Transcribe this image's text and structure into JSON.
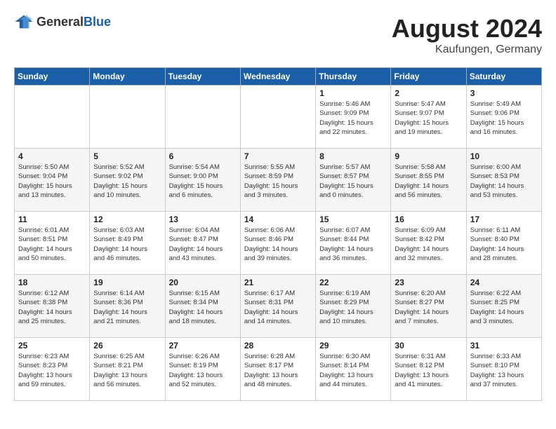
{
  "header": {
    "logo_general": "General",
    "logo_blue": "Blue",
    "title": "August 2024",
    "location": "Kaufungen, Germany"
  },
  "weekdays": [
    "Sunday",
    "Monday",
    "Tuesday",
    "Wednesday",
    "Thursday",
    "Friday",
    "Saturday"
  ],
  "weeks": [
    [
      {
        "day": "",
        "info": ""
      },
      {
        "day": "",
        "info": ""
      },
      {
        "day": "",
        "info": ""
      },
      {
        "day": "",
        "info": ""
      },
      {
        "day": "1",
        "info": "Sunrise: 5:46 AM\nSunset: 9:09 PM\nDaylight: 15 hours\nand 22 minutes."
      },
      {
        "day": "2",
        "info": "Sunrise: 5:47 AM\nSunset: 9:07 PM\nDaylight: 15 hours\nand 19 minutes."
      },
      {
        "day": "3",
        "info": "Sunrise: 5:49 AM\nSunset: 9:06 PM\nDaylight: 15 hours\nand 16 minutes."
      }
    ],
    [
      {
        "day": "4",
        "info": "Sunrise: 5:50 AM\nSunset: 9:04 PM\nDaylight: 15 hours\nand 13 minutes."
      },
      {
        "day": "5",
        "info": "Sunrise: 5:52 AM\nSunset: 9:02 PM\nDaylight: 15 hours\nand 10 minutes."
      },
      {
        "day": "6",
        "info": "Sunrise: 5:54 AM\nSunset: 9:00 PM\nDaylight: 15 hours\nand 6 minutes."
      },
      {
        "day": "7",
        "info": "Sunrise: 5:55 AM\nSunset: 8:59 PM\nDaylight: 15 hours\nand 3 minutes."
      },
      {
        "day": "8",
        "info": "Sunrise: 5:57 AM\nSunset: 8:57 PM\nDaylight: 15 hours\nand 0 minutes."
      },
      {
        "day": "9",
        "info": "Sunrise: 5:58 AM\nSunset: 8:55 PM\nDaylight: 14 hours\nand 56 minutes."
      },
      {
        "day": "10",
        "info": "Sunrise: 6:00 AM\nSunset: 8:53 PM\nDaylight: 14 hours\nand 53 minutes."
      }
    ],
    [
      {
        "day": "11",
        "info": "Sunrise: 6:01 AM\nSunset: 8:51 PM\nDaylight: 14 hours\nand 50 minutes."
      },
      {
        "day": "12",
        "info": "Sunrise: 6:03 AM\nSunset: 8:49 PM\nDaylight: 14 hours\nand 46 minutes."
      },
      {
        "day": "13",
        "info": "Sunrise: 6:04 AM\nSunset: 8:47 PM\nDaylight: 14 hours\nand 43 minutes."
      },
      {
        "day": "14",
        "info": "Sunrise: 6:06 AM\nSunset: 8:46 PM\nDaylight: 14 hours\nand 39 minutes."
      },
      {
        "day": "15",
        "info": "Sunrise: 6:07 AM\nSunset: 8:44 PM\nDaylight: 14 hours\nand 36 minutes."
      },
      {
        "day": "16",
        "info": "Sunrise: 6:09 AM\nSunset: 8:42 PM\nDaylight: 14 hours\nand 32 minutes."
      },
      {
        "day": "17",
        "info": "Sunrise: 6:11 AM\nSunset: 8:40 PM\nDaylight: 14 hours\nand 28 minutes."
      }
    ],
    [
      {
        "day": "18",
        "info": "Sunrise: 6:12 AM\nSunset: 8:38 PM\nDaylight: 14 hours\nand 25 minutes."
      },
      {
        "day": "19",
        "info": "Sunrise: 6:14 AM\nSunset: 8:36 PM\nDaylight: 14 hours\nand 21 minutes."
      },
      {
        "day": "20",
        "info": "Sunrise: 6:15 AM\nSunset: 8:34 PM\nDaylight: 14 hours\nand 18 minutes."
      },
      {
        "day": "21",
        "info": "Sunrise: 6:17 AM\nSunset: 8:31 PM\nDaylight: 14 hours\nand 14 minutes."
      },
      {
        "day": "22",
        "info": "Sunrise: 6:19 AM\nSunset: 8:29 PM\nDaylight: 14 hours\nand 10 minutes."
      },
      {
        "day": "23",
        "info": "Sunrise: 6:20 AM\nSunset: 8:27 PM\nDaylight: 14 hours\nand 7 minutes."
      },
      {
        "day": "24",
        "info": "Sunrise: 6:22 AM\nSunset: 8:25 PM\nDaylight: 14 hours\nand 3 minutes."
      }
    ],
    [
      {
        "day": "25",
        "info": "Sunrise: 6:23 AM\nSunset: 8:23 PM\nDaylight: 13 hours\nand 59 minutes."
      },
      {
        "day": "26",
        "info": "Sunrise: 6:25 AM\nSunset: 8:21 PM\nDaylight: 13 hours\nand 56 minutes."
      },
      {
        "day": "27",
        "info": "Sunrise: 6:26 AM\nSunset: 8:19 PM\nDaylight: 13 hours\nand 52 minutes."
      },
      {
        "day": "28",
        "info": "Sunrise: 6:28 AM\nSunset: 8:17 PM\nDaylight: 13 hours\nand 48 minutes."
      },
      {
        "day": "29",
        "info": "Sunrise: 6:30 AM\nSunset: 8:14 PM\nDaylight: 13 hours\nand 44 minutes."
      },
      {
        "day": "30",
        "info": "Sunrise: 6:31 AM\nSunset: 8:12 PM\nDaylight: 13 hours\nand 41 minutes."
      },
      {
        "day": "31",
        "info": "Sunrise: 6:33 AM\nSunset: 8:10 PM\nDaylight: 13 hours\nand 37 minutes."
      }
    ]
  ]
}
